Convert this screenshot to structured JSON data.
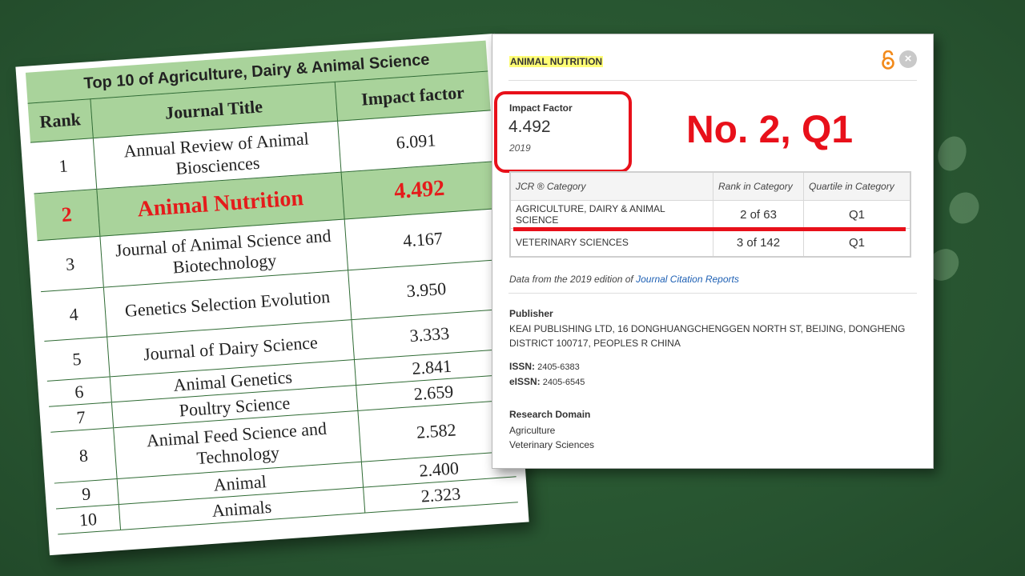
{
  "ranking_table": {
    "caption": "Top 10 of Agriculture, Dairy & Animal Science",
    "headers": {
      "rank": "Rank",
      "title": "Journal Title",
      "impact": "Impact factor"
    },
    "rows": [
      {
        "rank": "1",
        "title": "Annual Review of Animal Biosciences",
        "impact": "6.091"
      },
      {
        "rank": "2",
        "title": "Animal Nutrition",
        "impact": "4.492"
      },
      {
        "rank": "3",
        "title": "Journal of Animal Science and Biotechnology",
        "impact": "4.167"
      },
      {
        "rank": "4",
        "title": "Genetics Selection Evolution",
        "impact": "3.950"
      },
      {
        "rank": "5",
        "title": "Journal of Dairy Science",
        "impact": "3.333"
      },
      {
        "rank": "6",
        "title": "Animal Genetics",
        "impact": "2.841"
      },
      {
        "rank": "7",
        "title": "Poultry Science",
        "impact": "2.659"
      },
      {
        "rank": "8",
        "title": "Animal Feed Science and Technology",
        "impact": "2.582"
      },
      {
        "rank": "9",
        "title": "Animal",
        "impact": "2.400"
      },
      {
        "rank": "10",
        "title": "Animals",
        "impact": "2.323"
      }
    ]
  },
  "popup": {
    "journal_name": "ANIMAL NUTRITION",
    "close_glyph": "×",
    "impact_factor_label": "Impact Factor",
    "impact_factor_value": "4.492",
    "impact_factor_year": "2019",
    "rank_note": "No. 2, Q1",
    "category_table": {
      "headers": {
        "category": "JCR ® Category",
        "rank": "Rank in Category",
        "quartile": "Quartile in Category"
      },
      "rows": [
        {
          "category": "AGRICULTURE, DAIRY & ANIMAL SCIENCE",
          "rank": "2 of 63",
          "quartile": "Q1"
        },
        {
          "category": "VETERINARY SCIENCES",
          "rank": "3 of 142",
          "quartile": "Q1"
        }
      ]
    },
    "data_note_prefix": "Data from the 2019 edition of ",
    "data_note_link": "Journal Citation Reports",
    "publisher_label": "Publisher",
    "publisher_text": "KEAI PUBLISHING LTD, 16 DONGHUANGCHENGGEN NORTH ST, BEIJING, DONGHENG DISTRICT 100717, PEOPLES R CHINA",
    "issn_label": "ISSN:",
    "issn_value": "2405-6383",
    "eissn_label": "eISSN:",
    "eissn_value": "2405-6545",
    "research_domain_label": "Research Domain",
    "research_domains": [
      "Agriculture",
      "Veterinary Sciences"
    ]
  },
  "colors": {
    "background": "#2a5a30",
    "table_highlight": "#a9d39b",
    "accent_red": "#e8101a",
    "link_blue": "#1e60b4",
    "journal_highlight": "#fffd75"
  },
  "icons": [
    "open-access-icon",
    "close-icon",
    "paw-print-icon"
  ]
}
